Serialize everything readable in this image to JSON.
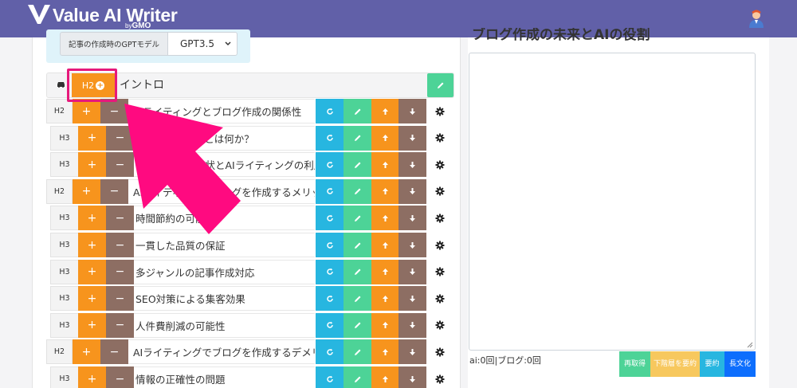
{
  "header": {
    "logo_text": "Value AI Writer",
    "logo_sub_by": "by",
    "logo_sub_brand": "GMO",
    "colors": {
      "bar": "#6160a8"
    }
  },
  "model": {
    "label": "記事の作成時のGPTモデル",
    "selected": "GPT3.5"
  },
  "intro": {
    "add_label": "H2",
    "title": "イントロ"
  },
  "outline": [
    {
      "level": "H2",
      "text": "AIライティングとブログ作成の関係性"
    },
    {
      "level": "H3",
      "text": "AIライティングとは何か？"
    },
    {
      "level": "H3",
      "text": "ブログ作成の現状とAIライティングの利用"
    },
    {
      "level": "H2",
      "text": "AIライティングでブログを作成するメリット"
    },
    {
      "level": "H3",
      "text": "時間節約の可能性"
    },
    {
      "level": "H3",
      "text": "一貫した品質の保証"
    },
    {
      "level": "H3",
      "text": "多ジャンルの記事作成対応"
    },
    {
      "level": "H3",
      "text": "SEO対策による集客効果"
    },
    {
      "level": "H3",
      "text": "人件費削減の可能性"
    },
    {
      "level": "H2",
      "text": "AIライティングでブログを作成するデメリット"
    },
    {
      "level": "H3",
      "text": "情報の正確性の問題"
    }
  ],
  "row_buttons": {
    "plus": "+",
    "minus": "−"
  },
  "right": {
    "title": "ブログ作成の未来とAIの役割",
    "counts": "ai:0回|ブログ:0回",
    "buttons": {
      "regen": "再取得",
      "lower": "下階層を要約",
      "summary": "要約",
      "long": "長文化"
    }
  },
  "icons": {
    "avatar": "user-avatar-icon",
    "car": "car-icon",
    "refresh": "refresh-icon",
    "edit": "pencil-icon",
    "up": "arrow-up-icon",
    "down": "arrow-down-icon",
    "gear": "gear-icon",
    "plus_circle": "plus-circle-icon"
  },
  "annotation": {
    "arrow_color": "#ff0a80",
    "box_color": "#e6197b"
  }
}
